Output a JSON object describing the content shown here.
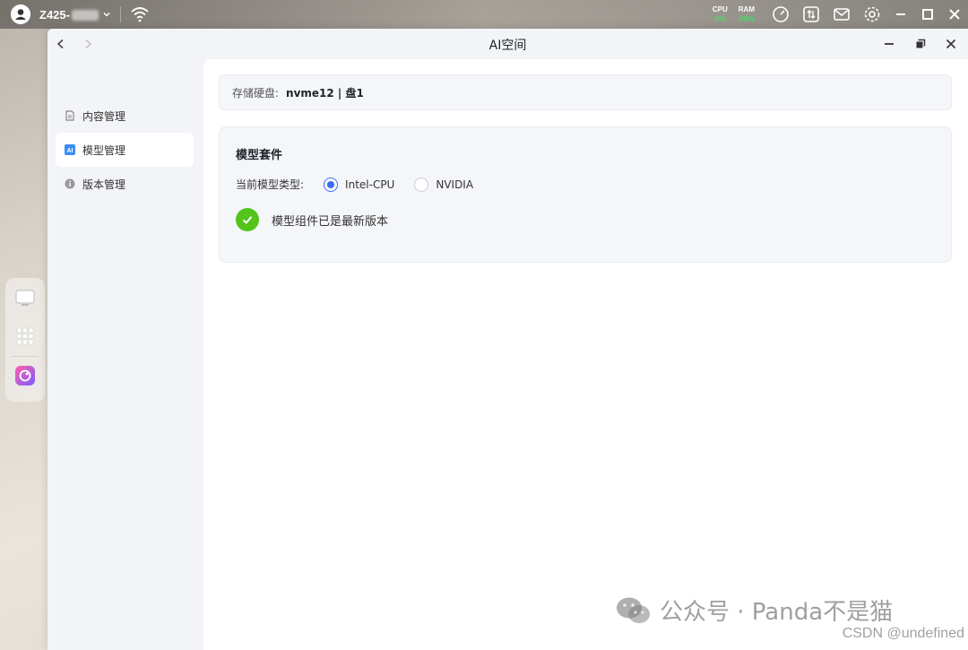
{
  "topbar": {
    "device_name": "Z425-",
    "cpu_label": "CPU",
    "cpu_value": "0%",
    "ram_label": "RAM",
    "ram_value": "38%"
  },
  "window": {
    "title": "AI空间"
  },
  "sidebar": {
    "items": [
      {
        "label": "内容管理",
        "icon": "document-icon"
      },
      {
        "label": "模型管理",
        "icon": "ai-icon",
        "active": true
      },
      {
        "label": "版本管理",
        "icon": "info-icon"
      }
    ]
  },
  "storage": {
    "label": "存储硬盘:",
    "value": "nvme12 | 盘1"
  },
  "model_card": {
    "title": "模型套件",
    "type_label": "当前模型类型:",
    "options": [
      "Intel-CPU",
      "NVIDIA"
    ],
    "selected": "Intel-CPU",
    "status_text": "模型组件已是最新版本"
  },
  "watermark": {
    "wechat": "公众号 · Panda不是猫",
    "csdn": "CSDN @undefined"
  },
  "colors": {
    "accent": "#3b6cf5",
    "success": "#52c41a",
    "stat_green": "#4cd964"
  }
}
